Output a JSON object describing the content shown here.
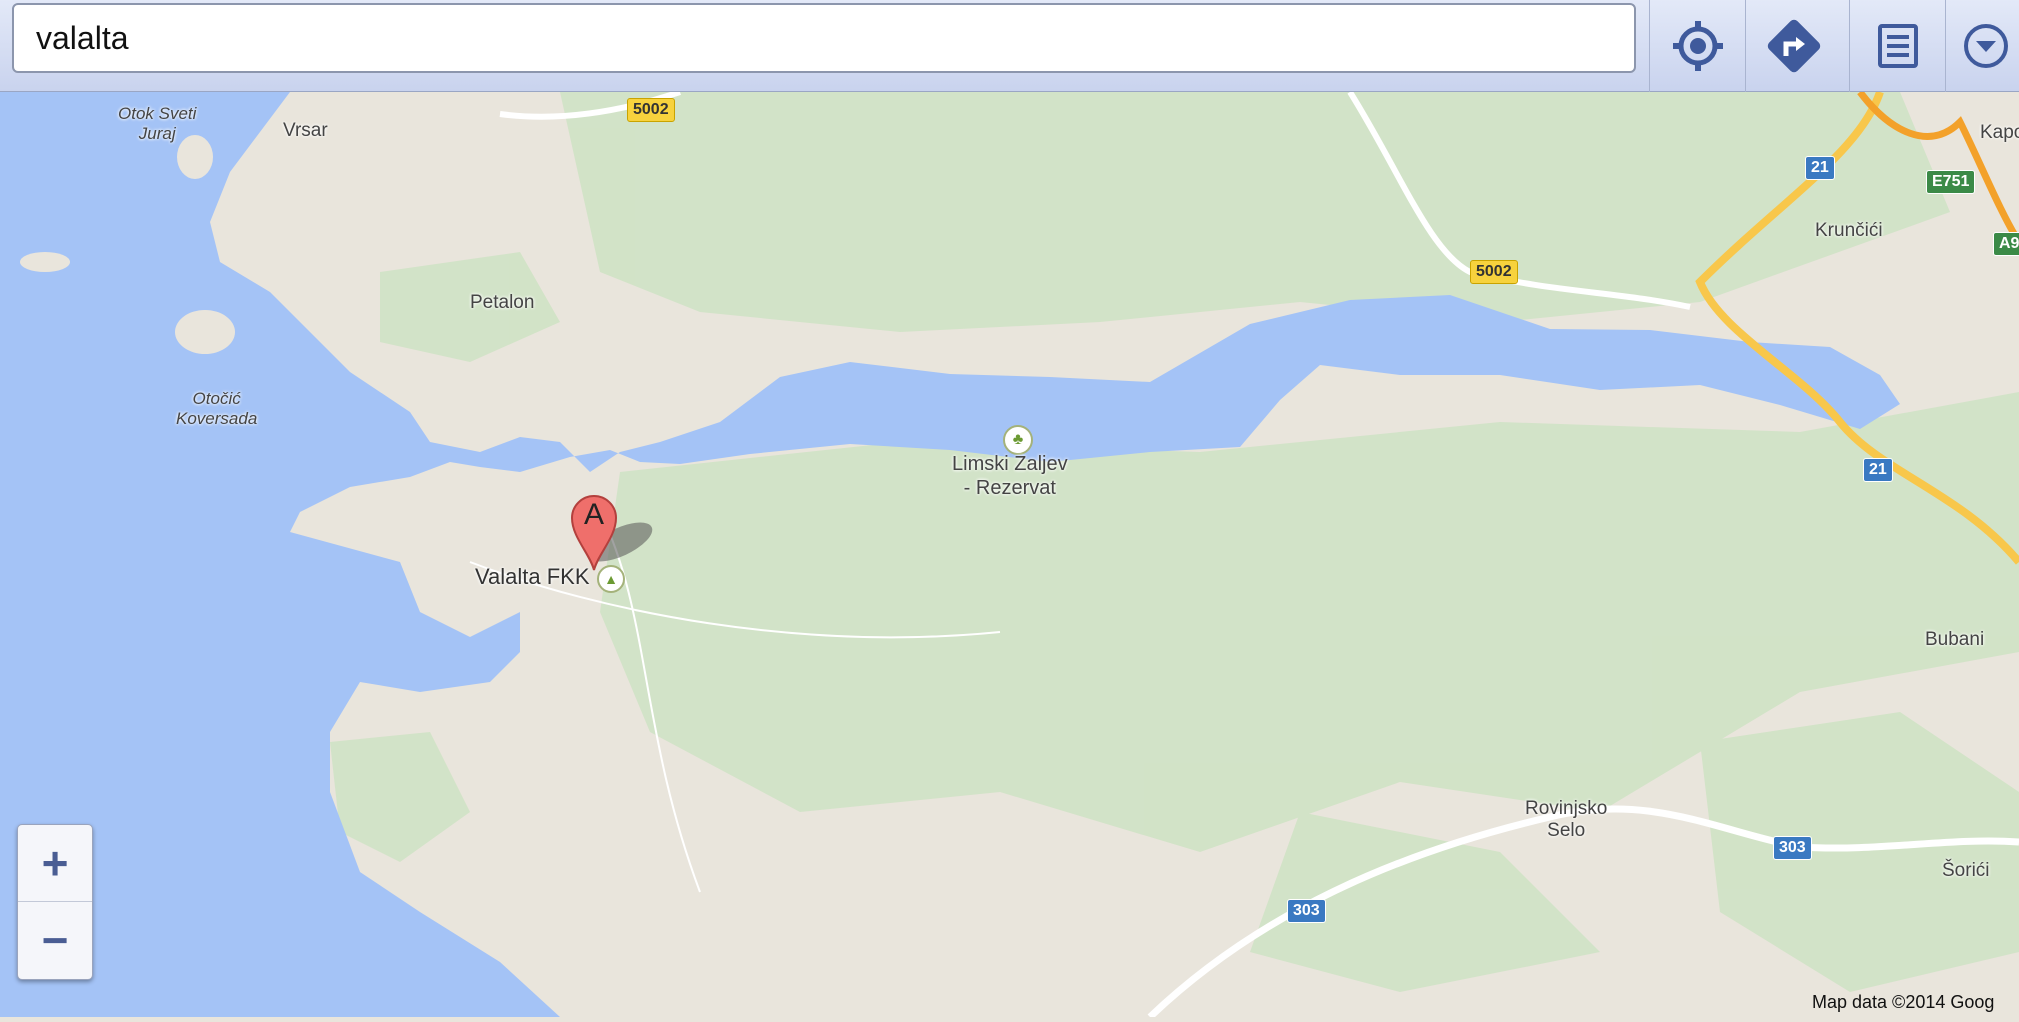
{
  "search": {
    "value": "valalta"
  },
  "toolbar": {
    "location_icon": "crosshair-location-icon",
    "directions_icon": "directions-turn-icon",
    "list_icon": "list-icon",
    "menu_icon": "chevron-down-circle-icon"
  },
  "map": {
    "water_color": "#a4c3f6",
    "land_color": "#e9e5dc",
    "forest_color": "#d1e3c6",
    "places": [
      {
        "id": "otok-sveti-juraj",
        "text": "Otok Sveti\nJuraj"
      },
      {
        "id": "vrsar",
        "text": "Vrsar"
      },
      {
        "id": "petalon",
        "text": "Petalon"
      },
      {
        "id": "otocic-koversada",
        "text": "Otočić\nKoversada"
      },
      {
        "id": "limski",
        "text": "Limski Zaljev\n- Rezervat"
      },
      {
        "id": "valalta-fkk",
        "text": "Valalta FKK"
      },
      {
        "id": "kruncici",
        "text": "Krunčići"
      },
      {
        "id": "kapo",
        "text": "Kapo"
      },
      {
        "id": "bubani",
        "text": "Bubani"
      },
      {
        "id": "rovinjsko-selo",
        "text": "Rovinjsko\nSelo"
      },
      {
        "id": "sorici",
        "text": "Šorići"
      }
    ],
    "road_shields": [
      {
        "id": "r5002a",
        "text": "5002",
        "type": "y"
      },
      {
        "id": "r5002b",
        "text": "5002",
        "type": "y"
      },
      {
        "id": "r21a",
        "text": "21",
        "type": "b"
      },
      {
        "id": "r21b",
        "text": "21",
        "type": "b"
      },
      {
        "id": "e751",
        "text": "E751",
        "type": "g"
      },
      {
        "id": "a9",
        "text": "A9",
        "type": "g"
      },
      {
        "id": "r303a",
        "text": "303",
        "type": "b"
      },
      {
        "id": "r303b",
        "text": "303",
        "type": "b"
      }
    ],
    "marker": {
      "label": "A",
      "color": "#ef6f6b"
    }
  },
  "zoom": {
    "in_label": "+",
    "out_label": "−"
  },
  "copyright": "Map data ©2014 Goog"
}
